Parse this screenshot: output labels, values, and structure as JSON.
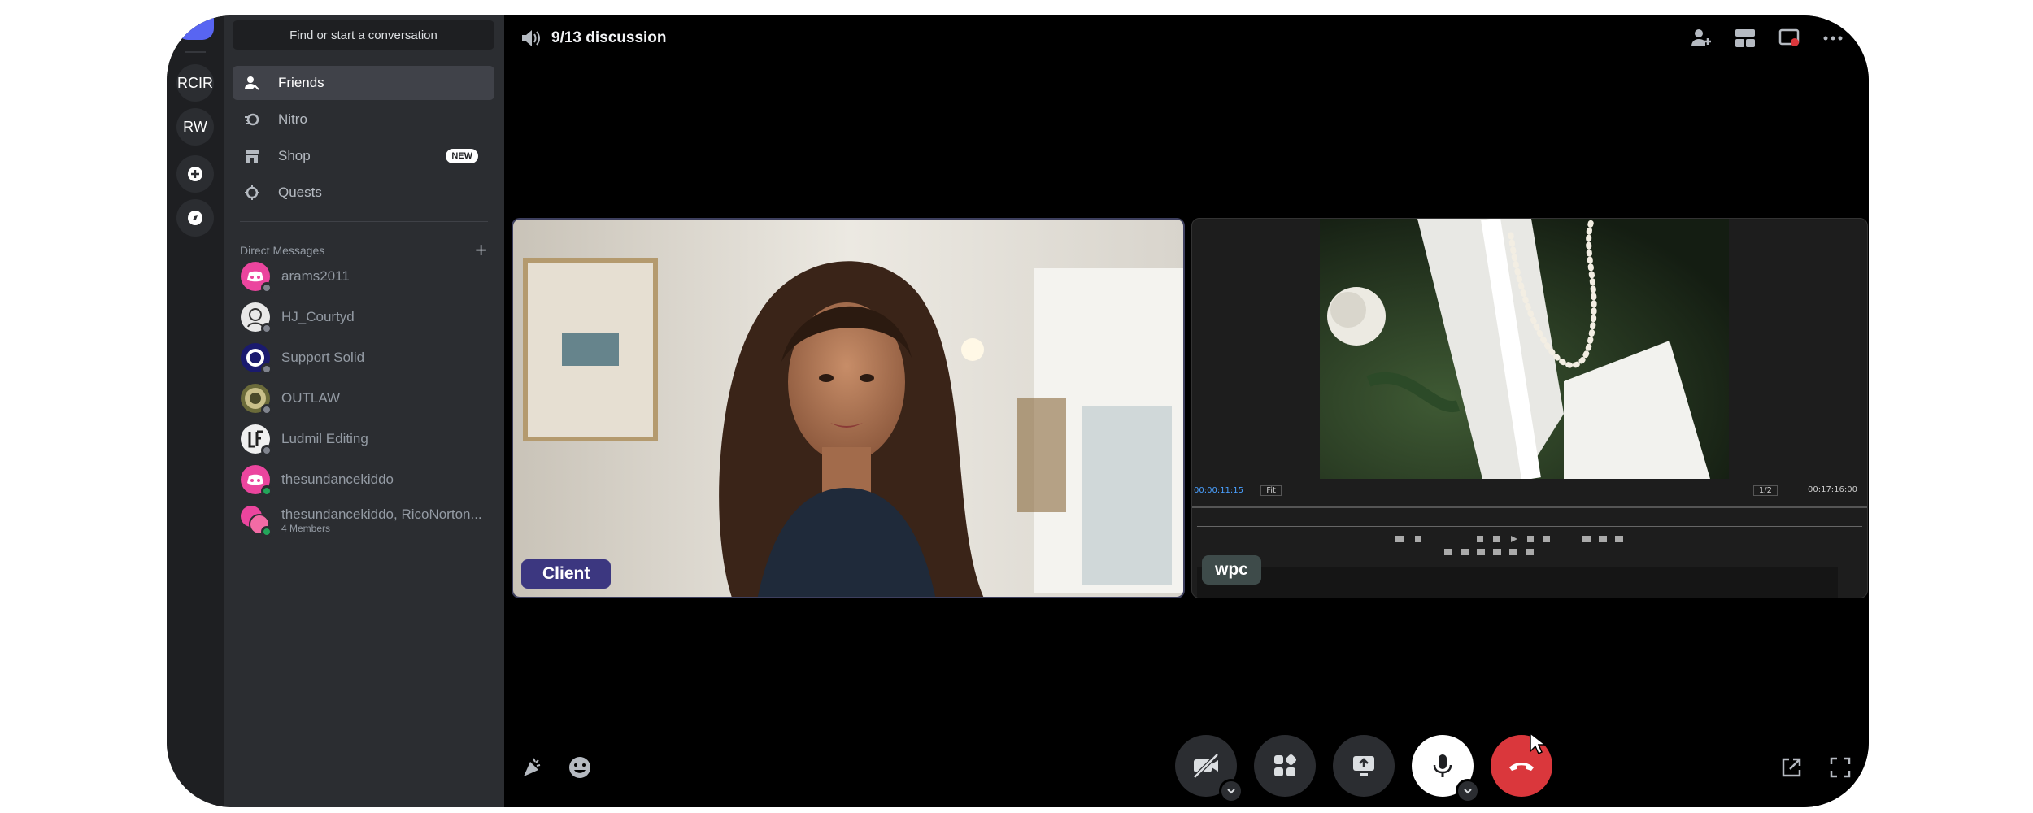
{
  "rail": {
    "items": [
      "RCIR",
      "RW"
    ]
  },
  "sidebar": {
    "search_placeholder": "Find or start a conversation",
    "nav": [
      {
        "label": "Friends",
        "icon": "friends-icon"
      },
      {
        "label": "Nitro",
        "icon": "nitro-icon"
      },
      {
        "label": "Shop",
        "icon": "shop-icon",
        "badge": "NEW"
      },
      {
        "label": "Quests",
        "icon": "quests-icon"
      }
    ],
    "dm_header": "Direct Messages",
    "dms": [
      {
        "name": "arams2011",
        "status": "offline",
        "color": "#eb459e"
      },
      {
        "name": "HJ_Courtyd",
        "status": "offline",
        "color": "#e8e8e8"
      },
      {
        "name": "Support Solid",
        "status": "offline",
        "color": "#1a1a6e"
      },
      {
        "name": "OUTLAW",
        "status": "offline",
        "color": "#6b6b3a"
      },
      {
        "name": "Ludmil Editing",
        "status": "offline",
        "color": "#f0f0f0"
      },
      {
        "name": "thesundancekiddo",
        "status": "online",
        "color": "#eb459e"
      },
      {
        "name": "thesundancekiddo, RicoNorton...",
        "sub": "4 Members",
        "status": "online",
        "color": "#eb459e"
      }
    ]
  },
  "call": {
    "title": "9/13 discussion",
    "participants": [
      {
        "name": "Client"
      },
      {
        "name": "wpc"
      }
    ],
    "editor": {
      "timecode": "00:00:11:15",
      "fit": "Fit",
      "scale": "1/2",
      "duration": "00:17:16:00"
    }
  },
  "colors": {
    "accent": "#5865f2",
    "hangup": "#da373c",
    "online": "#23a55a"
  }
}
